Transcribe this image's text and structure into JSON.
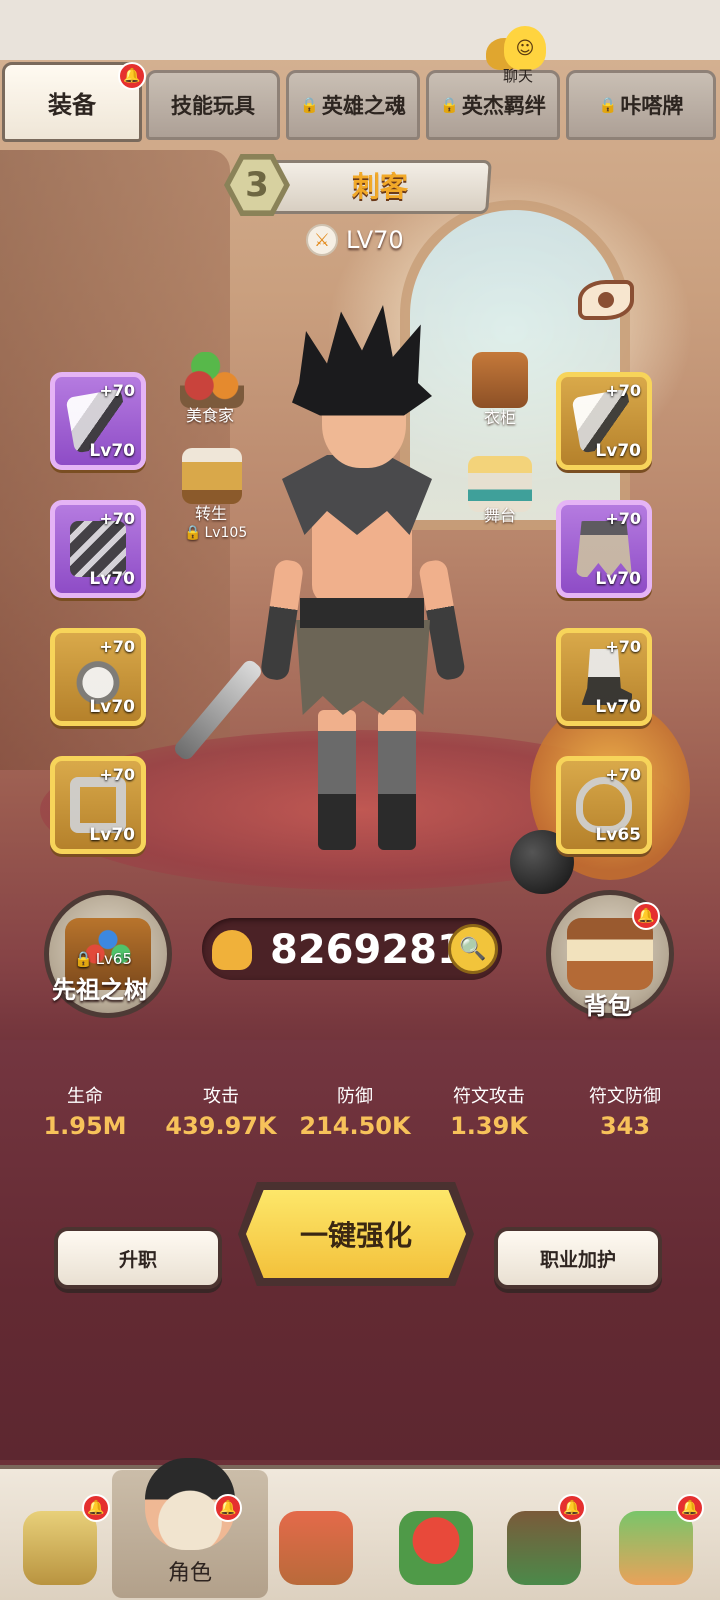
{
  "tabs": [
    {
      "label": "装备",
      "locked": false,
      "active": true
    },
    {
      "label": "技能玩具",
      "locked": false
    },
    {
      "label": "英雄之魂",
      "locked": true
    },
    {
      "label": "英杰羁绊",
      "locked": true
    },
    {
      "label": "咔嗒牌",
      "locked": true
    }
  ],
  "chat": {
    "label": "聊天",
    "icon": "chat-bubble-icon"
  },
  "character": {
    "rank": "3",
    "class_name": "刺客",
    "level": "LV70"
  },
  "side_icons": {
    "gourmet": {
      "label": "美食家"
    },
    "rebirth": {
      "label": "转生",
      "lock_level": "Lv105"
    },
    "wardrobe": {
      "label": "衣柜"
    },
    "stage": {
      "label": "舞台"
    }
  },
  "equipment_left": [
    {
      "plus": "+70",
      "level": "Lv70",
      "rarity": "purple",
      "icon": "weapon-icon"
    },
    {
      "plus": "+70",
      "level": "Lv70",
      "rarity": "purple",
      "icon": "belt-icon"
    },
    {
      "plus": "+70",
      "level": "Lv70",
      "rarity": "gold",
      "icon": "glove-icon"
    },
    {
      "plus": "+70",
      "level": "Lv70",
      "rarity": "gold",
      "icon": "ring-icon"
    }
  ],
  "equipment_right": [
    {
      "plus": "+70",
      "level": "Lv70",
      "rarity": "gold",
      "icon": "weapon-icon"
    },
    {
      "plus": "+70",
      "level": "Lv70",
      "rarity": "purple",
      "icon": "skirt-icon"
    },
    {
      "plus": "+70",
      "level": "Lv70",
      "rarity": "gold",
      "icon": "boot-icon"
    },
    {
      "plus": "+70",
      "level": "Lv65",
      "rarity": "gold",
      "icon": "necklace-icon"
    }
  ],
  "ancestor_tree": {
    "label": "先祖之树",
    "lock_level": "Lv65"
  },
  "power": {
    "value": "8269281"
  },
  "backpack": {
    "label": "背包"
  },
  "stats": [
    {
      "label": "生命",
      "value": "1.95M"
    },
    {
      "label": "攻击",
      "value": "439.97K"
    },
    {
      "label": "防御",
      "value": "214.50K"
    },
    {
      "label": "符文攻击",
      "value": "1.39K"
    },
    {
      "label": "符文防御",
      "value": "343"
    }
  ],
  "buttons": {
    "promote": "升职",
    "enhance_all": "一键强化",
    "class_protect": "职业加护"
  },
  "bottom_nav": {
    "active_label": "角色"
  },
  "colors": {
    "accent_gold": "#f7c25a",
    "notify_red": "#e5302f",
    "purple_rarity": "#9b5bd3"
  }
}
